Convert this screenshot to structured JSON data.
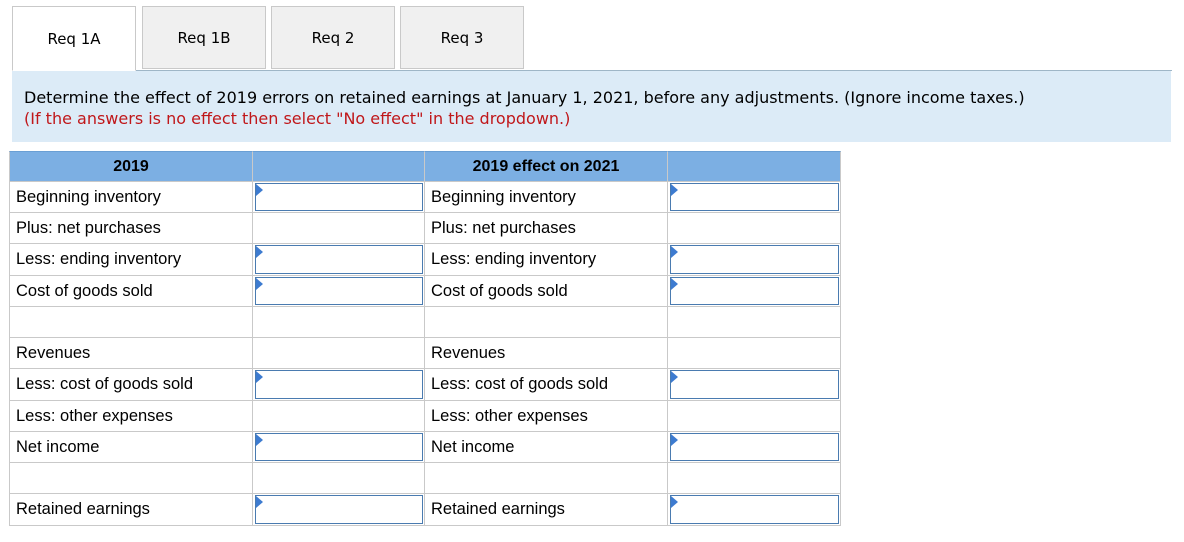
{
  "tabs": [
    {
      "label": "Req 1A",
      "active": true
    },
    {
      "label": "Req 1B",
      "active": false
    },
    {
      "label": "Req 2",
      "active": false
    },
    {
      "label": "Req 3",
      "active": false
    }
  ],
  "instructions": {
    "main": "Determine the effect of 2019 errors on retained earnings at January 1, 2021, before any adjustments. (Ignore income taxes.)",
    "note": "(If the answers is no effect then select \"No effect\" in the dropdown.)"
  },
  "table": {
    "headers": [
      "2019",
      "",
      "2019 effect on 2021",
      ""
    ],
    "rows": [
      {
        "left": "Beginning inventory",
        "left_input": true,
        "right": "Beginning inventory",
        "right_input": true
      },
      {
        "left": "Plus: net purchases",
        "left_input": false,
        "right": "Plus: net purchases",
        "right_input": false
      },
      {
        "left": "Less: ending inventory",
        "left_input": true,
        "right": "Less: ending inventory",
        "right_input": true
      },
      {
        "left": "Cost of goods sold",
        "left_input": true,
        "right": "Cost of goods sold",
        "right_input": true
      },
      {
        "left": "",
        "left_input": false,
        "right": "",
        "right_input": false
      },
      {
        "left": "Revenues",
        "left_input": false,
        "right": "Revenues",
        "right_input": false
      },
      {
        "left": "Less: cost of goods sold",
        "left_input": true,
        "right": "Less: cost of goods sold",
        "right_input": true
      },
      {
        "left": "Less: other expenses",
        "left_input": false,
        "right": "Less: other expenses",
        "right_input": false
      },
      {
        "left": "Net income",
        "left_input": true,
        "right": "Net income",
        "right_input": true
      },
      {
        "left": "",
        "left_input": false,
        "right": "",
        "right_input": false
      },
      {
        "left": "Retained earnings",
        "left_input": true,
        "right": "Retained earnings",
        "right_input": true
      }
    ]
  },
  "colors": {
    "header_bg": "#7cafe3",
    "instruction_bg": "#dcebf7",
    "note_red": "#c0171a",
    "dropdown_marker": "#3d7bd0"
  }
}
